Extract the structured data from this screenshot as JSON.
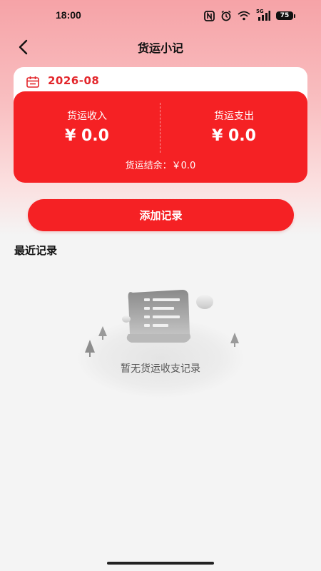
{
  "status_bar": {
    "time": "18:00",
    "network": "5G",
    "battery": "75"
  },
  "nav": {
    "title": "货运小记"
  },
  "summary": {
    "month": "2026-08",
    "income_label": "货运收入",
    "income_value": "¥ 0.0",
    "expense_label": "货运支出",
    "expense_value": "¥ 0.0",
    "balance_text": "货运结余：￥0.0"
  },
  "actions": {
    "add_record_label": "添加记录"
  },
  "recent": {
    "title": "最近记录",
    "empty_text": "暂无货运收支记录"
  },
  "icons": {
    "back": "chevron-left-icon",
    "calendar": "calendar-icon",
    "empty": "document-scroll-icon"
  },
  "colors": {
    "accent": "#f52124",
    "date_text": "#e3262b"
  }
}
